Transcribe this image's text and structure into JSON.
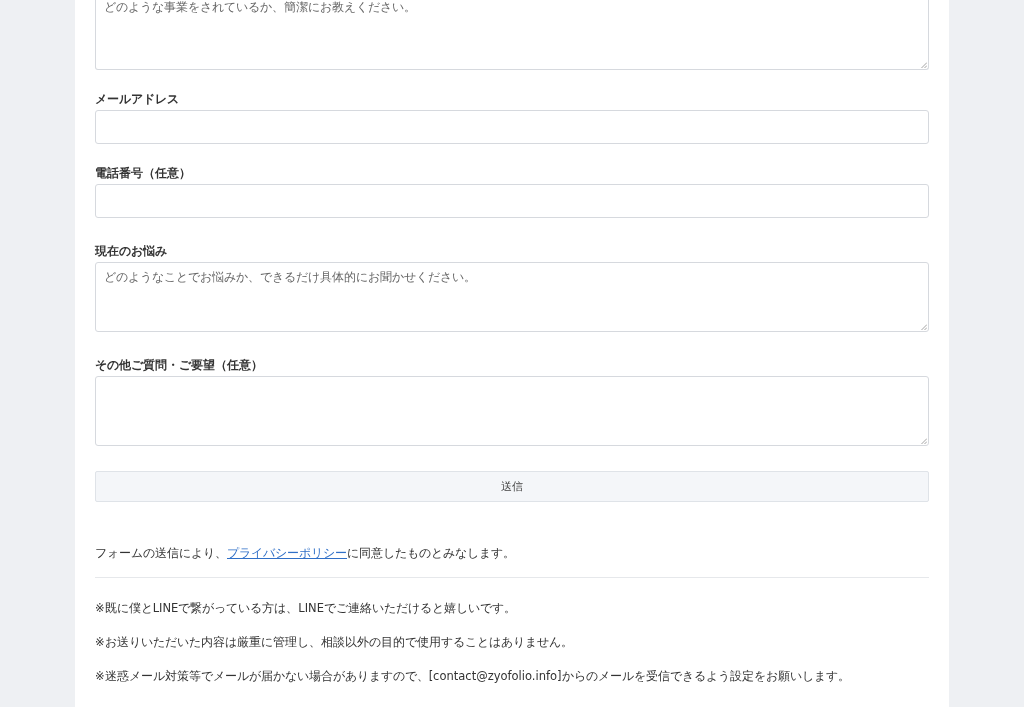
{
  "form": {
    "fields": [
      {
        "kind": "textarea",
        "placeholder": "どのような事業をされているか、簡潔にお教えください。"
      },
      {
        "kind": "input",
        "label": "メールアドレス"
      },
      {
        "kind": "input",
        "label": "電話番号（任意）"
      },
      {
        "kind": "textarea",
        "label": "現在のお悩み",
        "placeholder": "どのようなことでお悩みか、できるだけ具体的にお聞かせください。"
      },
      {
        "kind": "textarea",
        "label": "その他ご質問・ご要望（任意）"
      }
    ],
    "submit_button": "送信"
  },
  "consent": {
    "before": "フォームの送信により、",
    "link": "プライバシーポリシー",
    "after": "に同意したものとみなします。"
  },
  "notes": [
    "※既に僕とLINEで繋がっている方は、LINEでご連絡いただけると嬉しいです。",
    "※お送りいただいた内容は厳重に管理し、相談以外の目的で使用することはありません。",
    "※迷惑メール対策等でメールが届かない場合がありますので、[contact@zyofolio.info]からのメールを受信できるよう設定をお願いします。"
  ]
}
